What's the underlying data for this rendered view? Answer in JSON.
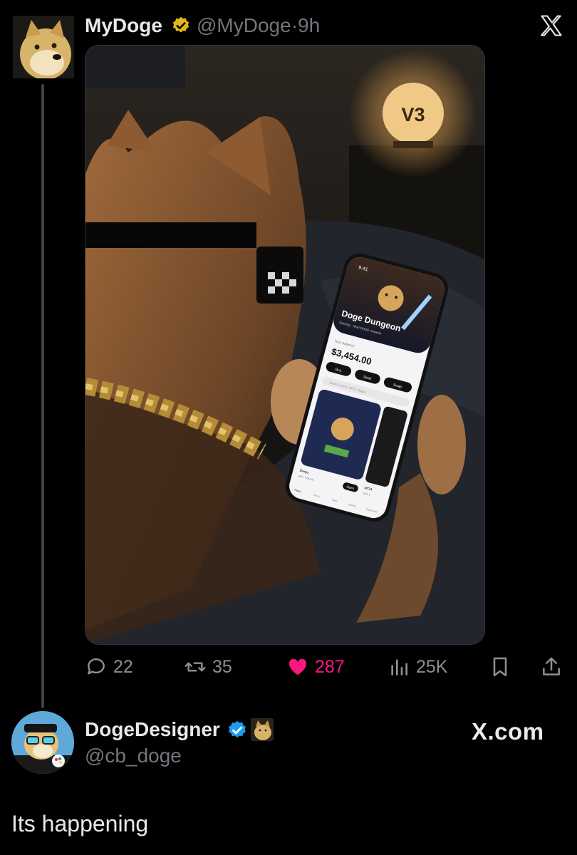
{
  "tweet": {
    "author_name": "MyDoge",
    "handle": "@MyDoge",
    "separator": "·",
    "time": "9h",
    "platform_icon": "x-logo-icon",
    "verified_color": "#e2b719"
  },
  "media": {
    "lamp_label": "V3",
    "phone": {
      "status_time": "9:41",
      "app_title": "Doge Dungeon",
      "app_subtitle": "Gaming · Real DOGE rewards",
      "balance_label": "Your balance",
      "balance": "$3,454.00",
      "buttons": [
        "Buy",
        "Send",
        "Swap"
      ],
      "search_placeholder": "Search coins, NFTs, dapps",
      "card_title": "Derps",
      "card_sub": "APY +78.2%",
      "open_label": "Open",
      "card2_title": "MOA",
      "card2_sub": "APY 2",
      "nav_items": [
        "Home",
        "Items",
        "Stats",
        "Activity",
        "Dogechain"
      ]
    }
  },
  "actions": {
    "replies": "22",
    "reposts": "35",
    "likes": "287",
    "views": "25K",
    "like_color": "#f91880"
  },
  "reply": {
    "author_name": "DogeDesigner",
    "handle": "@cb_doge",
    "site_label": "X.com",
    "text": "Its happening",
    "verified_color": "#1d9bf0"
  }
}
